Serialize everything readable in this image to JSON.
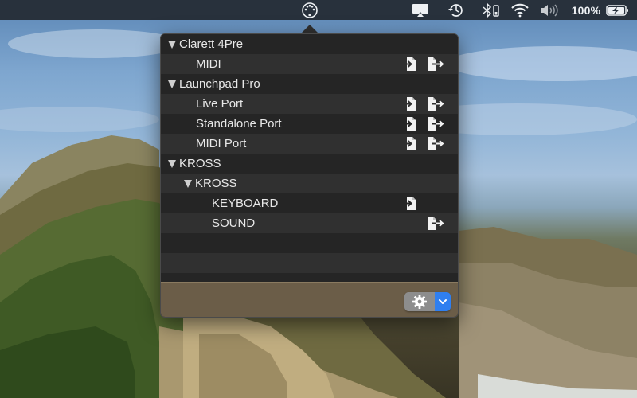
{
  "menubar": {
    "battery_percent": "100%",
    "icons": [
      "midi-connector-icon",
      "airplay-icon",
      "time-machine-icon",
      "bluetooth-icon",
      "wifi-icon",
      "volume-icon",
      "battery-charging-icon"
    ]
  },
  "popover": {
    "rows": [
      {
        "label": "Clarett 4Pre",
        "kind": "device"
      },
      {
        "label": "MIDI",
        "kind": "port",
        "input": true,
        "output": true
      },
      {
        "label": "Launchpad Pro",
        "kind": "device"
      },
      {
        "label": "Live Port",
        "kind": "port",
        "input": true,
        "output": true
      },
      {
        "label": "Standalone Port",
        "kind": "port",
        "input": true,
        "output": true
      },
      {
        "label": "MIDI Port",
        "kind": "port",
        "input": true,
        "output": true
      },
      {
        "label": "KROSS",
        "kind": "device"
      },
      {
        "label": "KROSS",
        "kind": "entity"
      },
      {
        "label": "KEYBOARD",
        "kind": "port",
        "input": true,
        "output": false
      },
      {
        "label": "SOUND",
        "kind": "port",
        "input": false,
        "output": true
      }
    ],
    "footer": {
      "gear_icon": "gear-icon",
      "menu_icon": "chevron-down-icon",
      "accent": "#2f7ff0"
    }
  }
}
